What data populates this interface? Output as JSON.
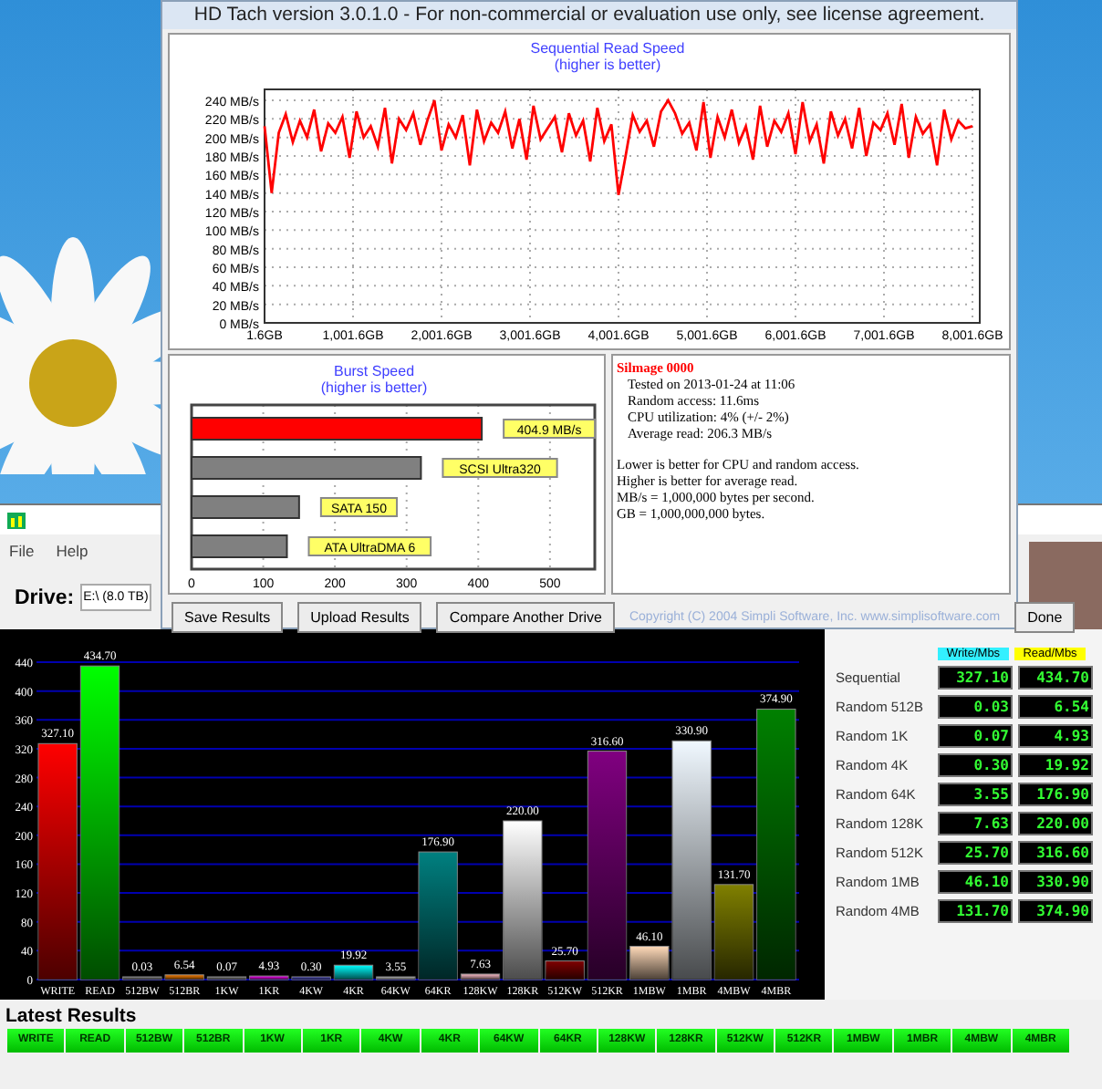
{
  "hdtach_window": {
    "title": "HD Tach version 3.0.1.0  - For non-commercial or evaluation use only, see license agreement.",
    "sequential_chart": {
      "chart_data": {
        "type": "line",
        "title": "Sequential Read Speed",
        "subtitle": "(higher is better)",
        "grid": true,
        "xlim": [
          1.6,
          8001.6
        ],
        "ylim": [
          0,
          240
        ],
        "xticks": [
          {
            "value": 1.6,
            "label": "1.6GB"
          },
          {
            "value": 1001.6,
            "label": "1,001.6GB"
          },
          {
            "value": 2001.6,
            "label": "2,001.6GB"
          },
          {
            "value": 3001.6,
            "label": "3,001.6GB"
          },
          {
            "value": 4001.6,
            "label": "4,001.6GB"
          },
          {
            "value": 5001.6,
            "label": "5,001.6GB"
          },
          {
            "value": 6001.6,
            "label": "6,001.6GB"
          },
          {
            "value": 7001.6,
            "label": "7,001.6GB"
          },
          {
            "value": 8001.6,
            "label": "8,001.6GB"
          }
        ],
        "yticks": [
          {
            "value": 0,
            "label": "0 MB/s"
          },
          {
            "value": 20,
            "label": "20 MB/s"
          },
          {
            "value": 40,
            "label": "40 MB/s"
          },
          {
            "value": 60,
            "label": "60 MB/s"
          },
          {
            "value": 80,
            "label": "80 MB/s"
          },
          {
            "value": 100,
            "label": "100 MB/s"
          },
          {
            "value": 120,
            "label": "120 MB/s"
          },
          {
            "value": 140,
            "label": "140 MB/s"
          },
          {
            "value": 160,
            "label": "160 MB/s"
          },
          {
            "value": 180,
            "label": "180 MB/s"
          },
          {
            "value": 200,
            "label": "200 MB/s"
          },
          {
            "value": 220,
            "label": "220 MB/s"
          },
          {
            "value": 240,
            "label": "240 MB/s"
          }
        ],
        "x": [
          1.6,
          81.6,
          161.6,
          241.6,
          321.6,
          401.6,
          481.6,
          561.6,
          641.6,
          721.6,
          801.6,
          881.6,
          961.6,
          1041.6,
          1121.6,
          1201.6,
          1281.6,
          1361.6,
          1441.6,
          1521.6,
          1601.6,
          1681.6,
          1761.6,
          1841.6,
          1921.6,
          2001.6,
          2081.6,
          2161.6,
          2241.6,
          2321.6,
          2401.6,
          2481.6,
          2561.6,
          2641.6,
          2721.6,
          2801.6,
          2881.6,
          2961.6,
          3041.6,
          3121.6,
          3201.6,
          3281.6,
          3361.6,
          3441.6,
          3521.6,
          3601.6,
          3681.6,
          3761.6,
          3841.6,
          3921.6,
          4001.6,
          4081.6,
          4161.6,
          4241.6,
          4321.6,
          4401.6,
          4481.6,
          4561.6,
          4641.6,
          4721.6,
          4801.6,
          4881.6,
          4961.6,
          5041.6,
          5121.6,
          5201.6,
          5281.6,
          5361.6,
          5441.6,
          5521.6,
          5601.6,
          5681.6,
          5761.6,
          5841.6,
          5921.6,
          6001.6,
          6081.6,
          6161.6,
          6241.6,
          6321.6,
          6401.6,
          6481.6,
          6561.6,
          6641.6,
          6721.6,
          6801.6,
          6881.6,
          6961.6,
          7041.6,
          7121.6,
          7201.6,
          7281.6,
          7361.6,
          7441.6,
          7521.6,
          7601.6,
          7681.6,
          7761.6,
          7841.6,
          7921.6,
          8001.6
        ],
        "series": [
          {
            "color": "#ff0000",
            "values": [
              212,
              140,
              205,
              225,
              195,
              218,
              200,
              230,
              185,
              215,
              205,
              222,
              178,
              228,
              200,
              212,
              190,
              232,
              172,
              220,
              208,
              226,
              192,
              218,
              240,
              186,
              214,
              200,
              224,
              170,
              230,
              196,
              216,
              205,
              228,
              188,
              220,
              176,
              234,
              198,
              210,
              222,
              184,
              226,
              202,
              218,
              174,
              232,
              196,
              214,
              138,
              180,
              224,
              206,
              218,
              190,
              228,
              240,
              226,
              204,
              216,
              186,
              238,
              178,
              222,
              200,
              230,
              194,
              212,
              176,
              234,
              190,
              218,
              206,
              226,
              182,
              238,
              196,
              214,
              172,
              228,
              202,
              220,
              188,
              232,
              180,
              216,
              208,
              226,
              192,
              236,
              178,
              222,
              204,
              214,
              170,
              230,
              198,
              218,
              210,
              212
            ]
          }
        ]
      }
    },
    "burst_chart": {
      "chart_data": {
        "type": "bar",
        "orientation": "horizontal",
        "title": "Burst Speed",
        "subtitle": "(higher is better)",
        "grid": true,
        "xlim": [
          0,
          560
        ],
        "xticks": [
          0,
          100,
          200,
          300,
          400,
          500
        ],
        "values": [
          404.9,
          320,
          150,
          133
        ],
        "colors": [
          "#ff0000",
          "#808080",
          "#808080",
          "#808080"
        ],
        "value_labels": [
          "404.9 MB/s",
          "SCSI Ultra320",
          "SATA 150",
          "ATA UltraDMA 6"
        ]
      }
    },
    "info": {
      "drive_name": "Silmage 0000",
      "details": [
        "Tested on 2013-01-24 at 11:06",
        "Random access: 11.6ms",
        "CPU utilization: 4% (+/- 2%)",
        "Average read: 206.3 MB/s"
      ],
      "notes": [
        "Lower is better for CPU and random access.",
        "Higher is better for average read.",
        "MB/s = 1,000,000 bytes per second.",
        "GB = 1,000,000,000 bytes."
      ]
    },
    "buttons": [
      "Save Results",
      "Upload Results",
      "Compare Another Drive"
    ],
    "copyright": "Copyright (C) 2004 Simpli Software, Inc. www.simplisoftware.com",
    "done_button": "Done"
  },
  "benchmark_window": {
    "menu": [
      "File",
      "Help"
    ],
    "drive_label": "Drive:",
    "drive_value": "E:\\ (8.0 TB)",
    "results_chart": {
      "chart_data": {
        "type": "bar",
        "data_labels": true,
        "grid": true,
        "ylim": [
          0,
          440
        ],
        "yticks": [
          0,
          40,
          80,
          120,
          160,
          200,
          240,
          280,
          320,
          360,
          400,
          440
        ],
        "categories": [
          "WRITE",
          "READ",
          "512BW",
          "512BR",
          "1KW",
          "1KR",
          "4KW",
          "4KR",
          "64KW",
          "64KR",
          "128KW",
          "128KR",
          "512KW",
          "512KR",
          "1MBW",
          "1MBR",
          "4MBW",
          "4MBR"
        ],
        "values": [
          327.1,
          434.7,
          0.03,
          6.54,
          0.07,
          4.93,
          0.3,
          19.92,
          3.55,
          176.9,
          7.63,
          220.0,
          25.7,
          316.6,
          46.1,
          330.9,
          131.7,
          374.9
        ],
        "value_labels": [
          "327.10",
          "434.70",
          "0.03",
          "6.54",
          "0.07",
          "4.93",
          "0.30",
          "19.92",
          "3.55",
          "176.90",
          "7.63",
          "220.00",
          "25.70",
          "316.60",
          "46.10",
          "330.90",
          "131.70",
          "374.90"
        ],
        "colors": [
          "#ff0000",
          "#00ff00",
          "#808080",
          "#ff8000",
          "#808080",
          "#ff00ff",
          "#4040c0",
          "#00ffff",
          "#c0c0c0",
          "#008080",
          "#ffc0cb",
          "#ffffff",
          "#800000",
          "#800080",
          "#ffdab9",
          "#f0f8ff",
          "#808000",
          "#008000"
        ]
      }
    },
    "results_table": {
      "columns": [
        "Write/Mbs",
        "Read/Mbs"
      ],
      "rows": [
        {
          "label": "Sequential",
          "write": "327.10",
          "read": "434.70"
        },
        {
          "label": "Random 512B",
          "write": "0.03",
          "read": "6.54"
        },
        {
          "label": "Random 1K",
          "write": "0.07",
          "read": "4.93"
        },
        {
          "label": "Random 4K",
          "write": "0.30",
          "read": "19.92"
        },
        {
          "label": "Random 64K",
          "write": "3.55",
          "read": "176.90"
        },
        {
          "label": "Random 128K",
          "write": "7.63",
          "read": "220.00"
        },
        {
          "label": "Random 512K",
          "write": "25.70",
          "read": "316.60"
        },
        {
          "label": "Random 1MB",
          "write": "46.10",
          "read": "330.90"
        },
        {
          "label": "Random 4MB",
          "write": "131.70",
          "read": "374.90"
        }
      ]
    },
    "latest_results": {
      "title": "Latest Results",
      "columns": [
        "WRITE",
        "READ",
        "512BW",
        "512BR",
        "1KW",
        "1KR",
        "4KW",
        "4KR",
        "64KW",
        "64KR",
        "128KW",
        "128KR",
        "512KW",
        "512KR",
        "1MBW",
        "1MBR",
        "4MBW",
        "4MBR"
      ]
    }
  }
}
